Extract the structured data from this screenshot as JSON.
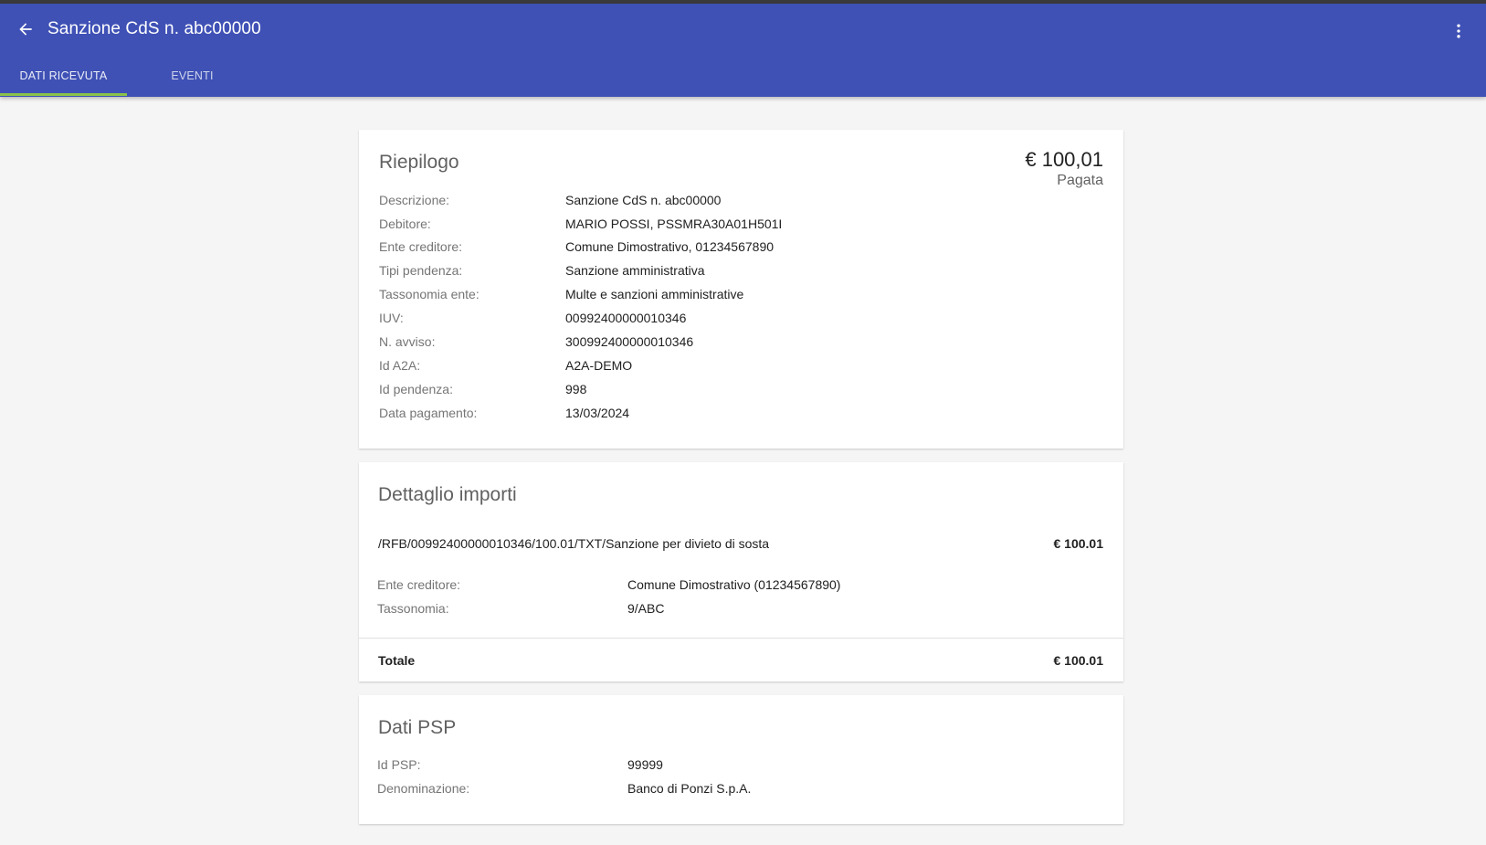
{
  "header": {
    "title": "Sanzione CdS n. abc00000",
    "back_icon": "arrow-back-icon",
    "menu_icon": "more-vert-icon",
    "tabs": [
      {
        "label": "DATI RICEVUTA",
        "active": true
      },
      {
        "label": "EVENTI",
        "active": false
      }
    ],
    "colors": {
      "bar": "#3f51b5",
      "tab_indicator": "#8bc34a"
    }
  },
  "riepilogo": {
    "title": "Riepilogo",
    "amount": "€ 100,01",
    "status": "Pagata",
    "rows": [
      {
        "label": "Descrizione:",
        "value": "Sanzione CdS n. abc00000"
      },
      {
        "label": "Debitore:",
        "value": "MARIO POSSI, PSSMRA30A01H501I"
      },
      {
        "label": "Ente creditore:",
        "value": "Comune Dimostrativo, 01234567890"
      },
      {
        "label": "Tipi pendenza:",
        "value": "Sanzione amministrativa"
      },
      {
        "label": "Tassonomia ente:",
        "value": "Multe e sanzioni amministrative"
      },
      {
        "label": "IUV:",
        "value": "00992400000010346"
      },
      {
        "label": "N. avviso:",
        "value": "300992400000010346"
      },
      {
        "label": "Id A2A:",
        "value": "A2A-DEMO"
      },
      {
        "label": "Id pendenza:",
        "value": "998"
      },
      {
        "label": "Data pagamento:",
        "value": "13/03/2024"
      }
    ]
  },
  "dettaglio": {
    "title": "Dettaglio importi",
    "item": {
      "causale": "/RFB/00992400000010346/100.01/TXT/Sanzione per divieto di sosta",
      "amount": "€ 100.01",
      "rows": [
        {
          "label": "Ente creditore:",
          "value": "Comune Dimostrativo (01234567890)"
        },
        {
          "label": "Tassonomia:",
          "value": "9/ABC"
        }
      ]
    },
    "total_label": "Totale",
    "total_amount": "€ 100.01"
  },
  "psp": {
    "title": "Dati PSP",
    "rows": [
      {
        "label": "Id PSP:",
        "value": "99999"
      },
      {
        "label": "Denominazione:",
        "value": "Banco di Ponzi S.p.A."
      }
    ]
  }
}
